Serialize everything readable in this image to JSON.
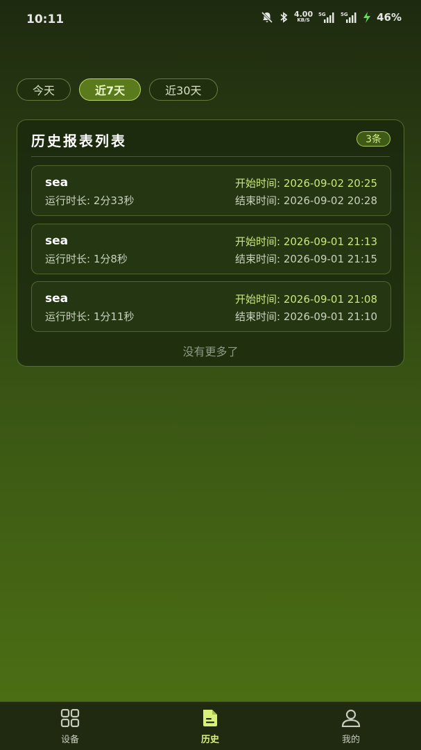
{
  "status_bar": {
    "time": "10:11",
    "net_speed_value": "4.00",
    "net_speed_unit": "KB/S",
    "battery": "46%"
  },
  "filters": {
    "tabs": [
      {
        "label": "今天",
        "active": false
      },
      {
        "label": "近7天",
        "active": true
      },
      {
        "label": "近30天",
        "active": false
      }
    ]
  },
  "report_list": {
    "title": "历史报表列表",
    "count_badge": "3条",
    "items": [
      {
        "name": "sea",
        "duration": "运行时长: 2分33秒",
        "start": "开始时间: 2026-09-02 20:25",
        "end": "结束时间: 2026-09-02 20:28"
      },
      {
        "name": "sea",
        "duration": "运行时长: 1分8秒",
        "start": "开始时间: 2026-09-01 21:13",
        "end": "结束时间: 2026-09-01 21:15"
      },
      {
        "name": "sea",
        "duration": "运行时长: 1分11秒",
        "start": "开始时间: 2026-09-01 21:08",
        "end": "结束时间: 2026-09-01 21:10"
      }
    ],
    "footer": "没有更多了"
  },
  "bottom_nav": {
    "items": [
      {
        "label": "设备",
        "icon": "grid-icon",
        "active": false
      },
      {
        "label": "历史",
        "icon": "document-icon",
        "active": true
      },
      {
        "label": "我的",
        "icon": "person-icon",
        "active": false
      }
    ]
  },
  "colors": {
    "accent": "#d9f07a",
    "start_time": "#c9e87a"
  }
}
